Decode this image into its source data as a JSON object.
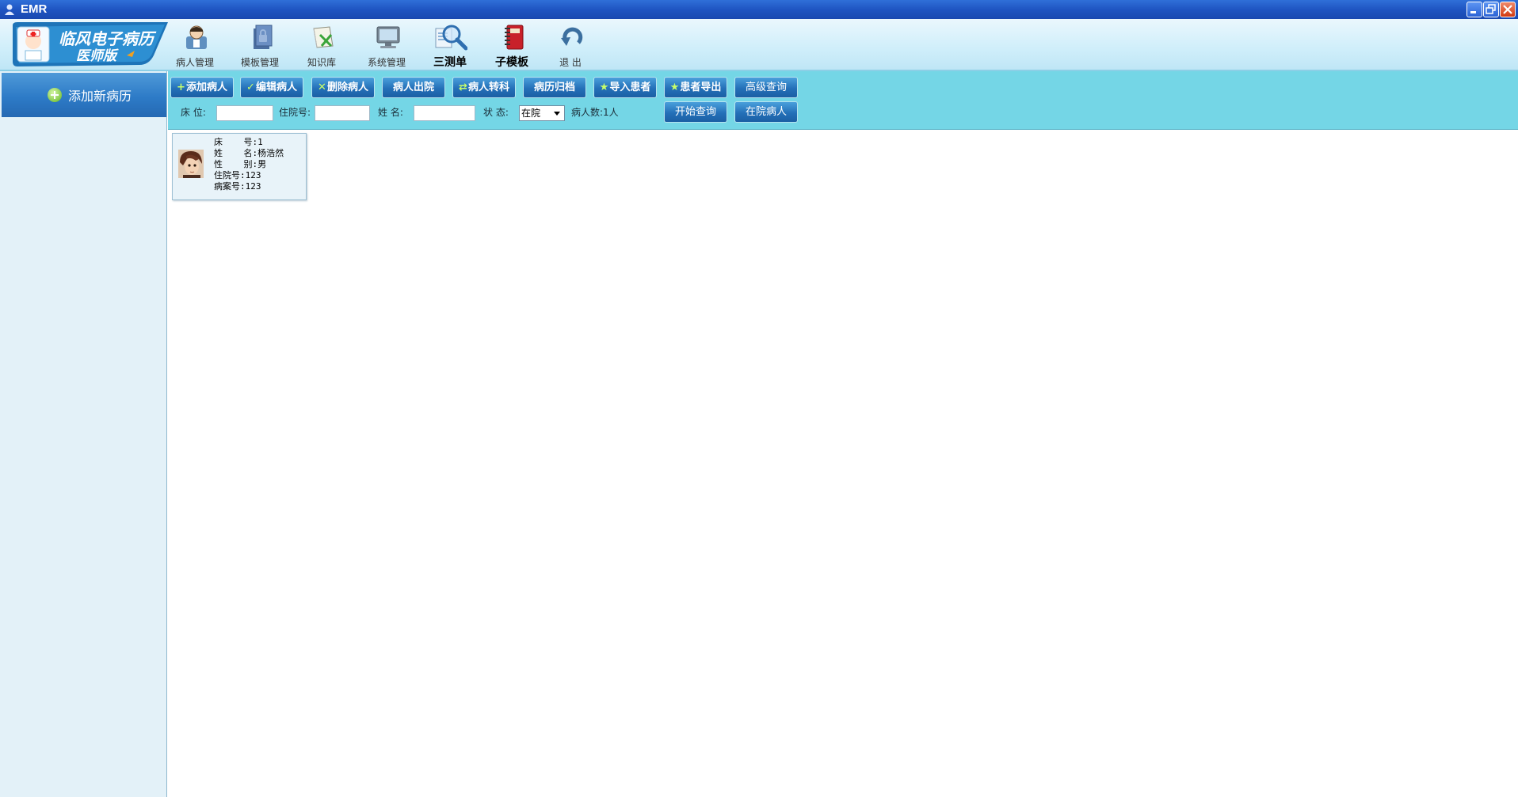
{
  "window": {
    "title": "EMR",
    "icons": [
      "app-icon",
      "minimize-icon",
      "restore-icon",
      "close-icon"
    ]
  },
  "toolbar": {
    "items": [
      {
        "label": "病人管理",
        "icon": "patient-management-icon"
      },
      {
        "label": "模板管理",
        "icon": "template-management-icon"
      },
      {
        "label": "知识库",
        "icon": "knowledge-base-icon"
      },
      {
        "label": "系统管理",
        "icon": "system-management-icon"
      },
      {
        "label": "三测单",
        "icon": "magnifier-icon"
      },
      {
        "label": "子模板",
        "icon": "notebook-icon"
      },
      {
        "label": "退  出",
        "icon": "exit-arrow-icon"
      }
    ]
  },
  "sidebar": {
    "add_record_label": "添加新病历"
  },
  "actions": {
    "add_patient": "添加病人",
    "edit_patient": "编辑病人",
    "delete_patient": "删除病人",
    "discharge": "病人出院",
    "transfer": "病人转科",
    "archive": "病历归档",
    "import": "导入患者",
    "export": "患者导出",
    "advanced_query": "高级查询",
    "start_query": "开始查询",
    "inpatients": "在院病人"
  },
  "filters": {
    "bed_label": "床    位:",
    "bed_value": "",
    "hospital_no_label": "住院号:",
    "hospital_no_value": "",
    "name_label": "姓    名:",
    "name_value": "",
    "status_label": "状    态:",
    "status_value": "在院",
    "count_text": "病人数:1人"
  },
  "patients": [
    {
      "bed": "床    号:1",
      "name": "姓    名:杨浩然",
      "sex": "性    别:男",
      "hospital_no": "住院号:123",
      "record_no": "病案号:123"
    }
  ],
  "colors": {
    "titlebar": "#1f55c2",
    "header": "#cfeefa",
    "actionbar": "#74d6e6",
    "button": "#2470b8",
    "sidebar": "#e3f1f8"
  }
}
